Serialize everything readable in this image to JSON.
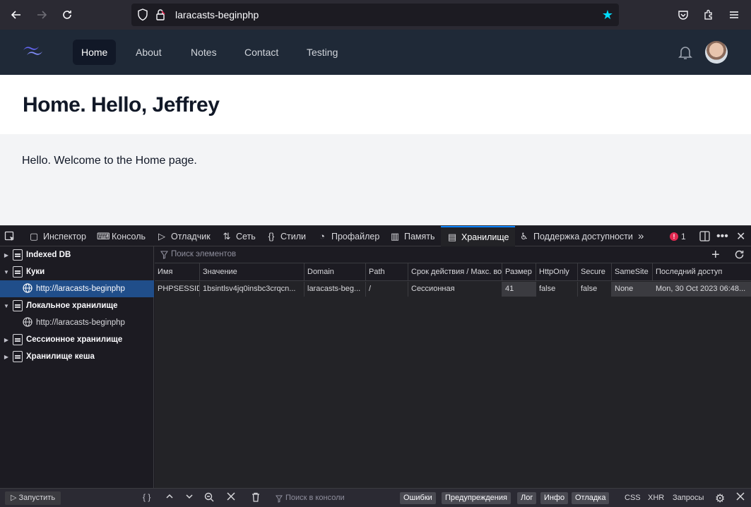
{
  "browser": {
    "url": "laracasts-beginphp"
  },
  "nav": {
    "links": [
      "Home",
      "About",
      "Notes",
      "Contact",
      "Testing"
    ]
  },
  "header": {
    "title": "Home. Hello, Jeffrey"
  },
  "main": {
    "text": "Hello. Welcome to the Home page."
  },
  "devtools": {
    "tabs": [
      "Инспектор",
      "Консоль",
      "Отладчик",
      "Сеть",
      "Стили",
      "Профайлер",
      "Память",
      "Хранилище",
      "Поддержка доступности"
    ],
    "error_count": "1",
    "tree": [
      {
        "label": "Indexed DB"
      },
      {
        "label": "Куки"
      },
      {
        "label": "http://laracasts-beginphp"
      },
      {
        "label": "Локальное хранилище"
      },
      {
        "label": "http://laracasts-beginphp"
      },
      {
        "label": "Сессионное хранилище"
      },
      {
        "label": "Хранилище кеша"
      }
    ],
    "filter_placeholder": "Поиск элементов",
    "columns": [
      "Имя",
      "Значение",
      "Domain",
      "Path",
      "Срок действия / Макс. возраст",
      "Размер",
      "HttpOnly",
      "Secure",
      "SameSite",
      "Последний доступ"
    ],
    "row": [
      "PHPSESSID",
      "1bsintlsv4jq0insbc3crqcn...",
      "laracasts-beg...",
      "/",
      "Сессионная",
      "41",
      "false",
      "false",
      "None",
      "Mon, 30 Oct 2023 06:48..."
    ]
  },
  "console": {
    "run_label": "Запустить",
    "filter_placeholder": "Поиск в консоли",
    "levels": [
      "Ошибки",
      "Предупреждения",
      "Лог",
      "Инфо",
      "Отладка"
    ],
    "extra": [
      "CSS",
      "XHR",
      "Запросы"
    ]
  }
}
